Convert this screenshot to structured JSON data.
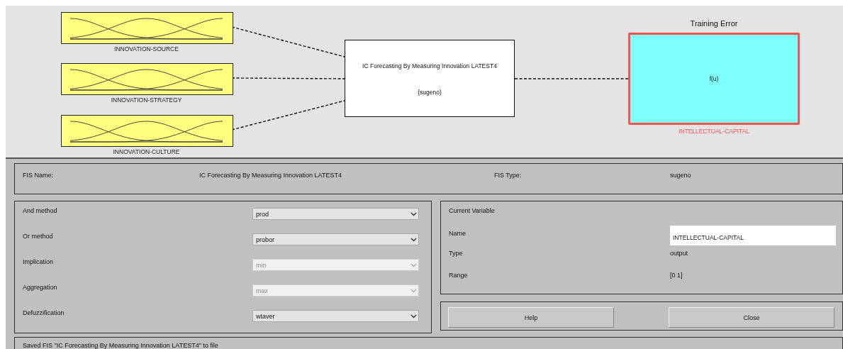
{
  "diagram": {
    "inputs": [
      {
        "name": "INNOVATION-SOURCE",
        "selected": false
      },
      {
        "name": "INNOVATION-STRATEGY",
        "selected": false
      },
      {
        "name": "INNOVATION-CULTURE",
        "selected": false
      }
    ],
    "system": {
      "title": "IC Forecasting By Measuring Innovation LATEST4",
      "type": "(sugeno)"
    },
    "output": {
      "title": "Training Error",
      "function": "f(u)",
      "name": "INTELLECTUAL-CAPITAL",
      "selected": true
    }
  },
  "fis_info": {
    "name_label": "FIS Name:",
    "name_value": "IC Forecasting By Measuring Innovation LATEST4",
    "type_label": "FIS Type:",
    "type_value": "sugeno"
  },
  "methods": [
    {
      "label": "And method",
      "value": "prod",
      "disabled": false
    },
    {
      "label": "Or method",
      "value": "probor",
      "disabled": false
    },
    {
      "label": "Implication",
      "value": "min",
      "disabled": true
    },
    {
      "label": "Aggregation",
      "value": "max",
      "disabled": true
    },
    {
      "label": "Defuzzification",
      "value": "wtaver",
      "disabled": false
    }
  ],
  "current_variable": {
    "title": "Current Variable",
    "name_label": "Name",
    "name_value": "INTELLECTUAL-CAPITAL",
    "type_label": "Type",
    "type_value": "output",
    "range_label": "Range",
    "range_value": "[0 1]"
  },
  "buttons": [
    "Help",
    "Close"
  ],
  "status": "Saved FIS \"IC Forecasting By Measuring Innovation LATEST4\" to file"
}
